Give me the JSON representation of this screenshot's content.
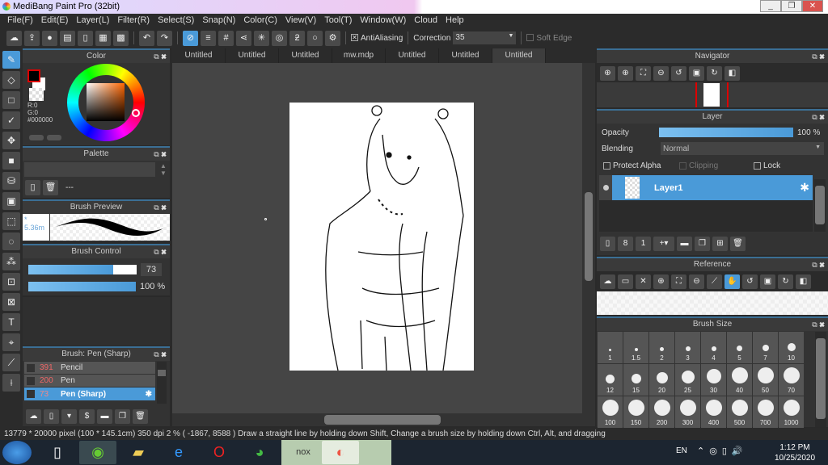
{
  "window": {
    "title": "MediBang Paint Pro (32bit)",
    "controls": [
      "_",
      "❐",
      "✕"
    ]
  },
  "menu": [
    "File(F)",
    "Edit(E)",
    "Layer(L)",
    "Filter(R)",
    "Select(S)",
    "Snap(N)",
    "Color(C)",
    "View(V)",
    "Tool(T)",
    "Window(W)",
    "Cloud",
    "Help"
  ],
  "toolbar": {
    "antialiasing_label": "AntiAliasing",
    "antialiasing_checked": true,
    "correction_label": "Correction",
    "correction_value": "35",
    "soft_edge_label": "Soft Edge",
    "soft_edge_checked": false
  },
  "tabs": [
    "Untitled",
    "Untitled",
    "Untitled",
    "mw.mdp",
    "Untitled",
    "Untitled",
    "Untitled"
  ],
  "active_tab": 6,
  "color_panel": {
    "title": "Color",
    "r": "R:0",
    "g": "G:0",
    "hex": "#000000",
    "foreground": "#000000",
    "background": "#ffffff"
  },
  "palette_panel": {
    "title": "Palette",
    "item": "---"
  },
  "brush_preview": {
    "title": "Brush Preview",
    "size": "* 5.36m"
  },
  "brush_control": {
    "title": "Brush Control",
    "size_value": "73",
    "size_fraction": 0.78,
    "opacity_value": "100 %",
    "opacity_fraction": 1.0
  },
  "brush_list": {
    "title": "Brush: Pen (Sharp)",
    "items": [
      {
        "size": "391",
        "name": "Pencil"
      },
      {
        "size": "200",
        "name": "Pen"
      },
      {
        "size": "73",
        "name": "Pen (Sharp)",
        "selected": true
      }
    ]
  },
  "navigator": {
    "title": "Navigator"
  },
  "layer_panel": {
    "title": "Layer",
    "opacity_label": "Opacity",
    "opacity_value": "100 %",
    "blending_label": "Blending",
    "blending_value": "Normal",
    "protect_alpha": "Protect Alpha",
    "clipping": "Clipping",
    "lock": "Lock",
    "layers": [
      {
        "name": "Layer1",
        "selected": true
      }
    ]
  },
  "reference_panel": {
    "title": "Reference"
  },
  "brush_size_panel": {
    "title": "Brush Size",
    "sizes": [
      "1",
      "1.5",
      "2",
      "3",
      "4",
      "5",
      "7",
      "10",
      "12",
      "15",
      "20",
      "25",
      "30",
      "40",
      "50",
      "70",
      "100",
      "150",
      "200",
      "300",
      "400",
      "500",
      "700",
      "1000"
    ]
  },
  "status": "13779 * 20000 pixel   (100 * 145.1cm)   350 dpi   2 %   ( -1867, 8588 )   Draw a straight line by holding down Shift, Change a brush size by holding down Ctrl, Alt, and dragging",
  "taskbar": {
    "lang": "EN",
    "time": "1:12 PM",
    "date": "10/25/2020"
  },
  "colors": {
    "accent": "#4a9ad8",
    "panel": "#333333",
    "canvas_bg": "#454545"
  }
}
